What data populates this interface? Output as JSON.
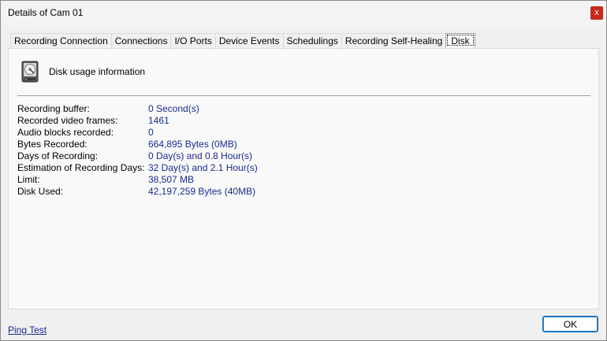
{
  "window": {
    "title": "Details of Cam 01",
    "close_label": "x"
  },
  "tabs": [
    {
      "label": "Recording Connection"
    },
    {
      "label": "Connections"
    },
    {
      "label": "I/O Ports"
    },
    {
      "label": "Device Events"
    },
    {
      "label": "Schedulings"
    },
    {
      "label": "Recording Self-Healing"
    },
    {
      "label": "Disk",
      "active": true
    }
  ],
  "panel": {
    "heading": "Disk usage information",
    "rows": [
      {
        "label": "Recording buffer:",
        "value": "0 Second(s)"
      },
      {
        "label": "Recorded video frames:",
        "value": "1461"
      },
      {
        "label": "Audio blocks recorded:",
        "value": "0"
      },
      {
        "label": "Bytes Recorded:",
        "value": "664,895 Bytes (0MB)"
      },
      {
        "label": "Days of Recording:",
        "value": "0 Day(s) and 0.8 Hour(s)"
      },
      {
        "label": "Estimation of Recording Days:",
        "value": "32 Day(s) and 2.1 Hour(s)"
      },
      {
        "label": "Limit:",
        "value": "38,507 MB"
      },
      {
        "label": "Disk Used:",
        "value": "42,197,259 Bytes (40MB)"
      }
    ]
  },
  "footer": {
    "ping_test_label": "Ping Test",
    "ok_label": "OK"
  },
  "colors": {
    "value_text": "#1a2a8c",
    "close_bg": "#c42b1c",
    "ok_border": "#0063b1"
  },
  "icons": {
    "close": "close-icon",
    "disk": "hard-disk-icon"
  }
}
